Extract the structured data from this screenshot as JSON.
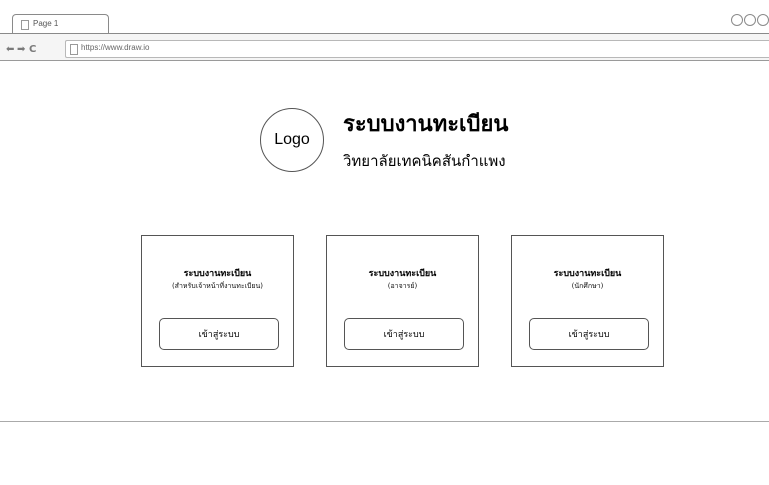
{
  "browser": {
    "tab_label": "Page 1",
    "url": "https://www.draw.io",
    "back_glyph": "⬅",
    "forward_glyph": "➡",
    "reload_glyph": "C"
  },
  "header": {
    "logo_text": "Logo",
    "title": "ระบบงานทะเบียน",
    "subtitle": "วิทยาลัยเทคนิคสันกำแพง"
  },
  "cards": [
    {
      "title": "ระบบงานทะเบียน",
      "subtitle": "(สำหรับเจ้าหน้าที่งานทะเบียน)",
      "button_label": "เข้าสู่ระบบ"
    },
    {
      "title": "ระบบงานทะเบียน",
      "subtitle": "(อาจารย์)",
      "button_label": "เข้าสู่ระบบ"
    },
    {
      "title": "ระบบงานทะเบียน",
      "subtitle": "(นักศึกษา)",
      "button_label": "เข้าสู่ระบบ"
    }
  ]
}
